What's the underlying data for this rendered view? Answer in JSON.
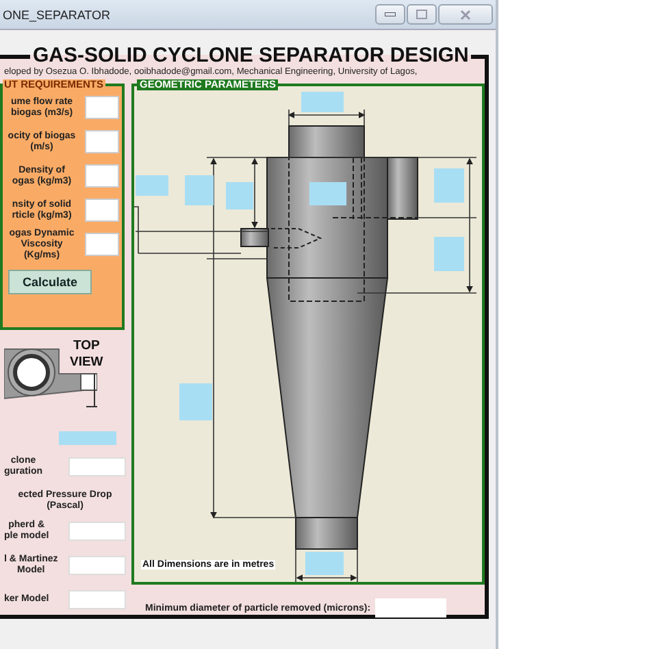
{
  "window": {
    "title": "ONE_SEPARATOR"
  },
  "header": {
    "title": "GAS-SOLID CYCLONE SEPARATOR DESIGN",
    "credits": "eloped by Osezua O. Ibhadode, ooibhadode@gmail.com, Mechanical Engineering, University of Lagos,"
  },
  "input_requirements": {
    "title": "UT REQUIREMENTS",
    "fields": [
      {
        "label": "ume flow rate\nbiogas (m3/s)"
      },
      {
        "label": "ocity of biogas\n(m/s)"
      },
      {
        "label": "Density of\nogas (kg/m3)"
      },
      {
        "label": "nsity of solid\nrticle (kg/m3)"
      },
      {
        "label": "ogas Dynamic\nViscosity\n(Kg/ms)"
      }
    ],
    "button": "Calculate"
  },
  "top_view": {
    "label": "TOP\nVIEW"
  },
  "configuration": {
    "label": "clone\nguration"
  },
  "pressure_drop": {
    "title": "ected Pressure Drop\n(Pascal)",
    "models": [
      {
        "label": "pherd &\nple model"
      },
      {
        "label": "l & Martinez\nModel"
      },
      {
        "label": "ker Model"
      }
    ]
  },
  "geometric_parameters": {
    "title": "GEOMETRIC PARAMETERS",
    "note": "All Dimensions are in metres"
  },
  "minimum_diameter": {
    "label": "Minimum diameter of particle removed (microns):"
  }
}
